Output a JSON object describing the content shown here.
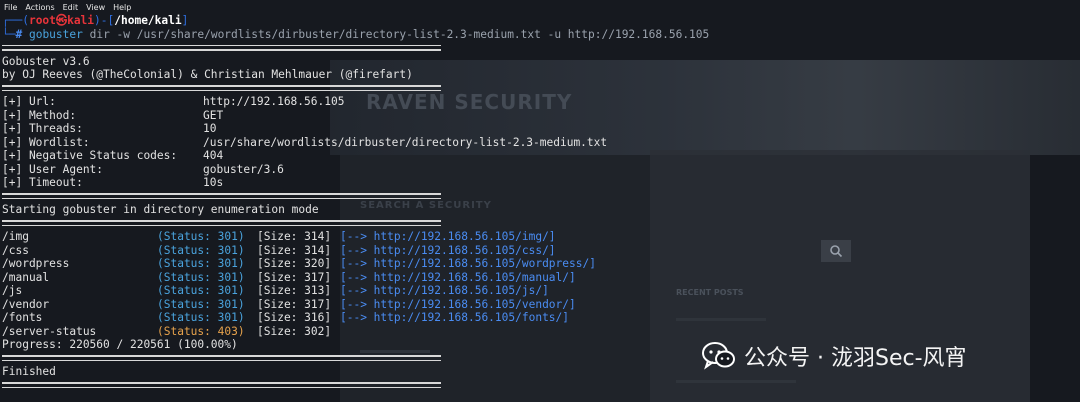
{
  "window": {
    "menu": [
      "File",
      "Actions",
      "Edit",
      "View",
      "Help"
    ]
  },
  "prompt": {
    "top_prefix": "┌──(",
    "user": "root㉿kali",
    "mid": ")-[",
    "cwd": "/home/kali",
    "end": "]",
    "bottom_prefix": "└─",
    "hash": "# ",
    "cmd": "gobuster",
    "cmd_args": " dir -w /usr/share/wordlists/dirbuster/directory-list-2.3-medium.txt -u http://192.168.56.105"
  },
  "banner": {
    "version": "Gobuster v3.6",
    "authors": "by OJ Reeves (@TheColonial) & Christian Mehlmauer (@firefart)"
  },
  "config": [
    {
      "key": "[+] Url:",
      "value": "http://192.168.56.105"
    },
    {
      "key": "[+] Method:",
      "value": "GET"
    },
    {
      "key": "[+] Threads:",
      "value": "10"
    },
    {
      "key": "[+] Wordlist:",
      "value": "/usr/share/wordlists/dirbuster/directory-list-2.3-medium.txt"
    },
    {
      "key": "[+] Negative Status codes:",
      "value": "404"
    },
    {
      "key": "[+] User Agent:",
      "value": "gobuster/3.6"
    },
    {
      "key": "[+] Timeout:",
      "value": "10s"
    }
  ],
  "start_message": "Starting gobuster in directory enumeration mode",
  "results": [
    {
      "path": "/img",
      "status": "(Status: 301)",
      "size": "[Size: 314]",
      "redirect": "[--> http://192.168.56.105/img/]"
    },
    {
      "path": "/css",
      "status": "(Status: 301)",
      "size": "[Size: 314]",
      "redirect": "[--> http://192.168.56.105/css/]"
    },
    {
      "path": "/wordpress",
      "status": "(Status: 301)",
      "size": "[Size: 320]",
      "redirect": "[--> http://192.168.56.105/wordpress/]"
    },
    {
      "path": "/manual",
      "status": "(Status: 301)",
      "size": "[Size: 317]",
      "redirect": "[--> http://192.168.56.105/manual/]"
    },
    {
      "path": "/js",
      "status": "(Status: 301)",
      "size": "[Size: 313]",
      "redirect": "[--> http://192.168.56.105/js/]"
    },
    {
      "path": "/vendor",
      "status": "(Status: 301)",
      "size": "[Size: 317]",
      "redirect": "[--> http://192.168.56.105/vendor/]"
    },
    {
      "path": "/fonts",
      "status": "(Status: 301)",
      "size": "[Size: 316]",
      "redirect": "[--> http://192.168.56.105/fonts/]"
    },
    {
      "path": "/server-status",
      "status": "(Status: 403)",
      "size": "[Size: 302]",
      "redirect": ""
    }
  ],
  "progress": "Progress: 220560 / 220561 (100.00%)",
  "finished": "Finished",
  "background_page": {
    "brand": "RAVEN SECURITY",
    "heading": "SEARCH A SECURITY",
    "recent": "RECENT POSTS"
  },
  "watermark": "公众号 · 泷羽Sec-风宵",
  "colors": {
    "prompt_blue": "#2f6fe0",
    "user_red": "#e8343a",
    "status_301": "#4aa3dd",
    "status_403": "#e6a24c",
    "link": "#4a8cf2"
  }
}
